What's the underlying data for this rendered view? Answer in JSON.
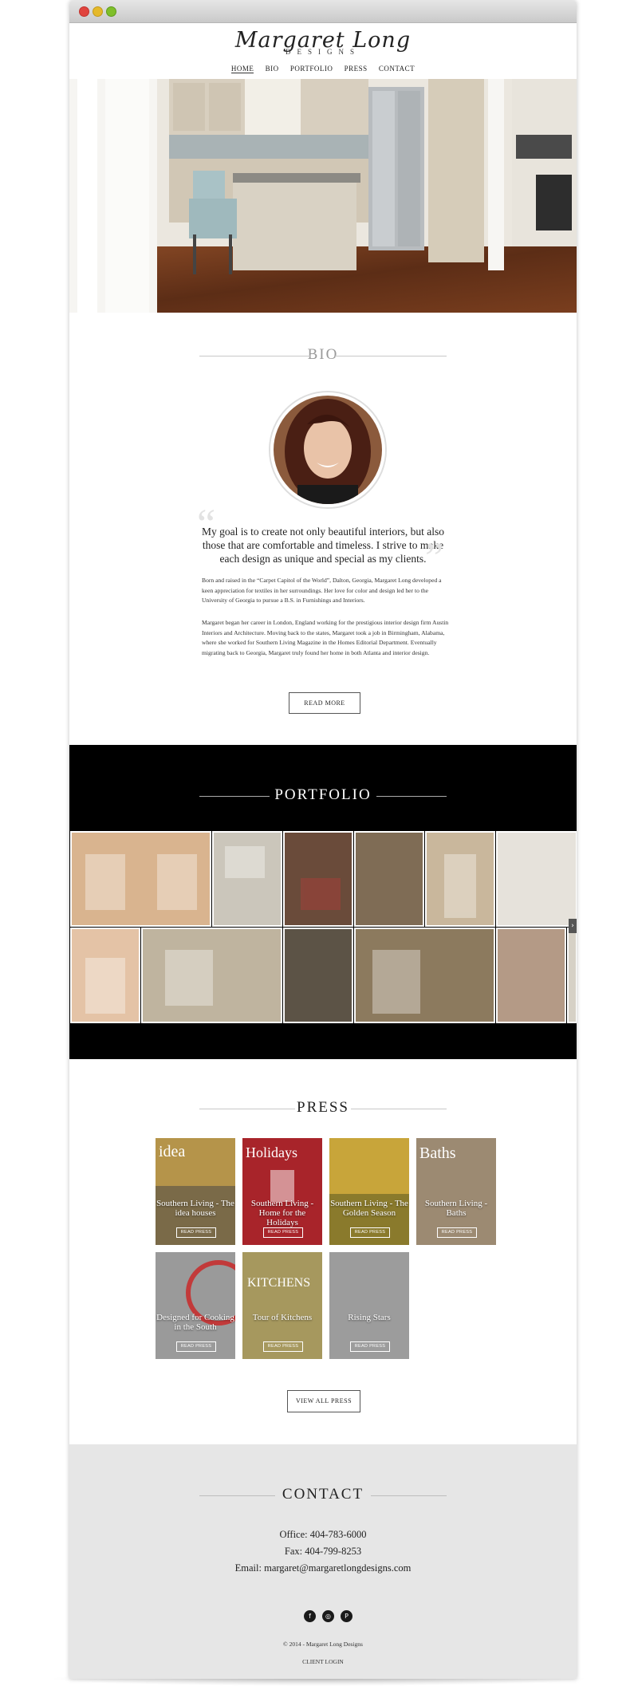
{
  "logo": {
    "script": "Margaret Long",
    "designs": "DESIGNS"
  },
  "nav": {
    "items": [
      "HOME",
      "BIO",
      "PORTFOLIO",
      "PRESS",
      "CONTACT"
    ]
  },
  "bio": {
    "title": "BIO",
    "quote": "My goal is to create not only beautiful interiors, but also those that are comfortable and timeless. I strive to make each design as unique and special as my clients.",
    "para1": "Born and raised in the “Carpet Capitol of the World”, Dalton, Georgia, Margaret Long developed a keen appreciation for textiles in her surroundings. Her love for color and design led her to the University of Georgia to pursue a B.S. in Furnishings and Interiors.",
    "para2": "Margaret began her career in London, England working for the prestigious interior design firm Austin Interiors and Architecture. Moving back to the states, Margaret took a job in Birmingham, Alabama, where she worked for Southern Living Magazine in the Homes Editorial Department. Eventually migrating back to Georgia, Margaret truly found her home in both Atlanta and interior design.",
    "read_more": "READ MORE"
  },
  "portfolio": {
    "title": "PORTFOLIO"
  },
  "press": {
    "title": "PRESS",
    "items": [
      {
        "title": "Southern Living - The idea houses",
        "button": "READ PRESS"
      },
      {
        "title": "Southern Living - Home for the Holidays",
        "button": "READ PRESS"
      },
      {
        "title": "Southern Living - The Golden Season",
        "button": "READ PRESS"
      },
      {
        "title": "Southern Living - Baths",
        "button": "READ PRESS"
      },
      {
        "title": "Designed for Cooking in the South",
        "button": "READ PRESS"
      },
      {
        "title": "Tour of Kitchens",
        "button": "READ PRESS"
      },
      {
        "title": "Rising Stars",
        "button": "READ PRESS"
      }
    ],
    "view_all": "VIEW ALL PRESS"
  },
  "contact": {
    "title": "CONTACT",
    "office": "Office: 404-783-6000",
    "fax": "Fax: 404-799-8253",
    "email": "Email: margaret@margaretlongdesigns.com",
    "social": [
      {
        "icon": "facebook-icon",
        "glyph": "f"
      },
      {
        "icon": "instagram-icon",
        "glyph": "◎"
      },
      {
        "icon": "pinterest-icon",
        "glyph": "P"
      }
    ],
    "copyright": "© 2014 - Margaret Long Designs",
    "client_login": "CLIENT LOGIN"
  },
  "colors": {
    "portfolio_bg": "#000000",
    "contact_bg": "#e6e6e6",
    "divider": "#c8c8c8"
  }
}
